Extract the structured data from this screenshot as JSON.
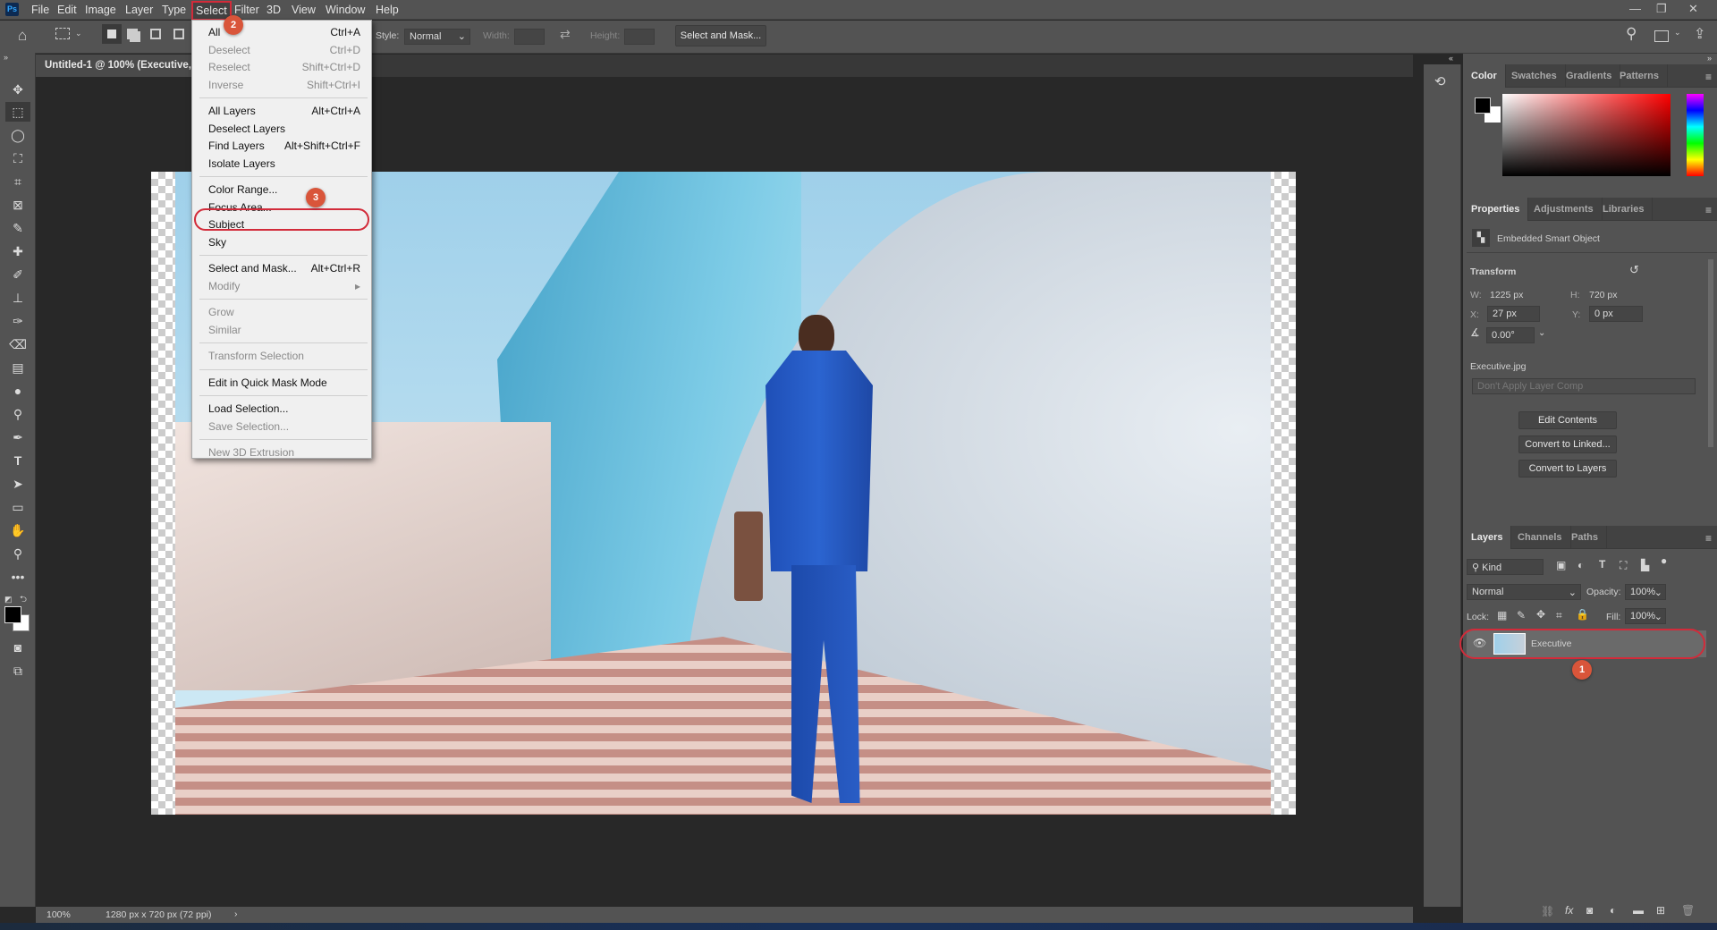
{
  "app": {
    "logo": "Ps",
    "menu": [
      "File",
      "Edit",
      "Image",
      "Layer",
      "Type",
      "Select",
      "Filter",
      "3D",
      "View",
      "Window",
      "Help"
    ],
    "active_menu": "Select",
    "window_controls": [
      "minimize-icon",
      "restore-icon",
      "close-icon"
    ]
  },
  "options": {
    "style_label": "Style:",
    "style_value": "Normal",
    "width_label": "Width:",
    "height_label": "Height:",
    "select_mask": "Select and Mask..."
  },
  "document": {
    "tab_title": "Untitled-1 @ 100% (Executive, RGB/8)",
    "zoom": "100%",
    "info": "1280 px x 720 px (72 ppi)"
  },
  "select_menu": {
    "groups": [
      [
        {
          "label": "All",
          "shortcut": "Ctrl+A",
          "enabled": true
        },
        {
          "label": "Deselect",
          "shortcut": "Ctrl+D",
          "enabled": false
        },
        {
          "label": "Reselect",
          "shortcut": "Shift+Ctrl+D",
          "enabled": false
        },
        {
          "label": "Inverse",
          "shortcut": "Shift+Ctrl+I",
          "enabled": false
        }
      ],
      [
        {
          "label": "All Layers",
          "shortcut": "Alt+Ctrl+A",
          "enabled": true
        },
        {
          "label": "Deselect Layers",
          "shortcut": "",
          "enabled": true
        },
        {
          "label": "Find Layers",
          "shortcut": "Alt+Shift+Ctrl+F",
          "enabled": true
        },
        {
          "label": "Isolate Layers",
          "shortcut": "",
          "enabled": true
        }
      ],
      [
        {
          "label": "Color Range...",
          "shortcut": "",
          "enabled": true
        },
        {
          "label": "Focus Area...",
          "shortcut": "",
          "enabled": true
        },
        {
          "label": "Subject",
          "shortcut": "",
          "enabled": true
        },
        {
          "label": "Sky",
          "shortcut": "",
          "enabled": true
        }
      ],
      [
        {
          "label": "Select and Mask...",
          "shortcut": "Alt+Ctrl+R",
          "enabled": true
        },
        {
          "label": "Modify",
          "shortcut": "▸",
          "enabled": false
        }
      ],
      [
        {
          "label": "Grow",
          "shortcut": "",
          "enabled": false
        },
        {
          "label": "Similar",
          "shortcut": "",
          "enabled": false
        }
      ],
      [
        {
          "label": "Transform Selection",
          "shortcut": "",
          "enabled": false
        }
      ],
      [
        {
          "label": "Edit in Quick Mask Mode",
          "shortcut": "",
          "enabled": true
        }
      ],
      [
        {
          "label": "Load Selection...",
          "shortcut": "",
          "enabled": true
        },
        {
          "label": "Save Selection...",
          "shortcut": "",
          "enabled": false
        }
      ],
      [
        {
          "label": "New 3D Extrusion",
          "shortcut": "",
          "enabled": false
        }
      ]
    ]
  },
  "annotations": {
    "step1": "1",
    "step2": "2",
    "step3": "3",
    "highlight_color": "#d22b3a",
    "badge_color": "#d9553a"
  },
  "color_panel": {
    "tabs": [
      "Color",
      "Swatches",
      "Gradients",
      "Patterns"
    ],
    "hue": "#ff0000",
    "foreground": "#000000",
    "background": "#ffffff"
  },
  "properties": {
    "tabs": [
      "Properties",
      "Adjustments",
      "Libraries"
    ],
    "type": "Embedded Smart Object",
    "transform_label": "Transform",
    "w_label": "W:",
    "w": "1225 px",
    "h_label": "H:",
    "h": "720 px",
    "x_label": "X:",
    "x": "27 px",
    "y_label": "Y:",
    "y": "0 px",
    "angle": "0.00°",
    "filename": "Executive.jpg",
    "layer_comp": "Don't Apply Layer Comp",
    "buttons": [
      "Edit Contents",
      "Convert to Linked...",
      "Convert to Layers"
    ]
  },
  "layers": {
    "tabs": [
      "Layers",
      "Channels",
      "Paths"
    ],
    "filter": "Kind",
    "blend": "Normal",
    "opacity_label": "Opacity:",
    "opacity": "100%",
    "lock_label": "Lock:",
    "fill_label": "Fill:",
    "fill": "100%",
    "items": [
      {
        "name": "Executive",
        "visible": true
      }
    ]
  }
}
